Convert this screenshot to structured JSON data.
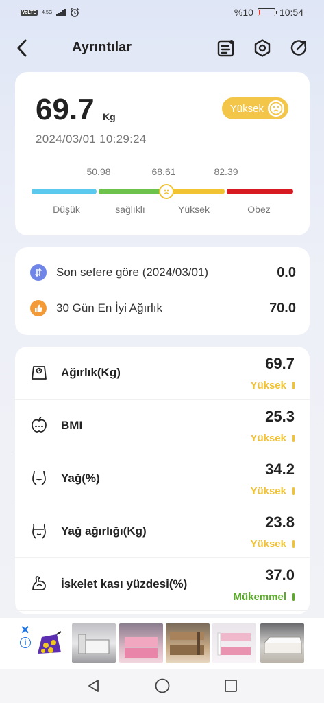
{
  "status_bar": {
    "carrier_chip": "VoLTE",
    "network": "4.5G",
    "battery_percent": "%10",
    "battery_level": 0.1,
    "time": "10:54"
  },
  "header": {
    "title": "Ayrıntılar",
    "icons": [
      "back-arrow-icon",
      "report-icon",
      "settings-hexagon-icon",
      "share-icon"
    ]
  },
  "summary": {
    "weight": "69.7",
    "unit": "Kg",
    "datetime": "2024/03/01 10:29:24",
    "status": "Yüksek",
    "status_color": "#f3c64a",
    "thresholds": [
      "50.98",
      "68.61",
      "82.39"
    ],
    "ranges": [
      {
        "label": "Düşük",
        "color": "#5bc8ee"
      },
      {
        "label": "sağlıklı",
        "color": "#6cc24a"
      },
      {
        "label": "Yüksek",
        "color": "#f1c232"
      },
      {
        "label": "Obez",
        "color": "#d71921"
      }
    ],
    "marker_value": 69.7
  },
  "compare": {
    "last_label": "Son sefere göre (2024/03/01)",
    "last_value": "0.0",
    "best_label": "30 Gün En İyi Ağırlık",
    "best_value": "70.0"
  },
  "metrics": [
    {
      "label": "Ağırlık(Kg)",
      "value": "69.7",
      "status": "Yüksek",
      "color": "#f1c232",
      "icon": "scale-icon"
    },
    {
      "label": "BMI",
      "value": "25.3",
      "status": "Yüksek",
      "color": "#f1c232",
      "icon": "apple-icon"
    },
    {
      "label": "Yağ(%)",
      "value": "34.2",
      "status": "Yüksek",
      "color": "#f1c232",
      "icon": "body-fat-icon"
    },
    {
      "label": "Yağ ağırlığı(Kg)",
      "value": "23.8",
      "status": "Yüksek",
      "color": "#f1c232",
      "icon": "waist-icon"
    },
    {
      "label": "İskelet kası yüzdesi(%)",
      "value": "37.0",
      "status": "Mükemmel",
      "color": "#5aac28",
      "icon": "muscle-arm-icon"
    }
  ],
  "nav": {
    "icons": [
      "back-triangle-icon",
      "home-circle-icon",
      "recents-square-icon"
    ]
  }
}
